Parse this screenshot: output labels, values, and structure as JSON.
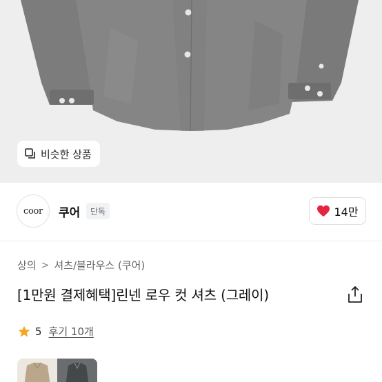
{
  "similar_button": {
    "label": "비슷한 상품",
    "icon": "copy-squares-icon"
  },
  "seller": {
    "avatar_text": "coor",
    "name": "쿠어",
    "badge": "단독",
    "likes": "14만",
    "heart_color": "#e5243f"
  },
  "breadcrumb": {
    "items": [
      "상의",
      "셔츠/블라우스 (쿠어)"
    ],
    "separator": ">"
  },
  "product": {
    "title": "[1만원 결제혜택]린넨 로우 컷 셔츠 (그레이)"
  },
  "rating": {
    "score": "5",
    "reviews": "후기 10개",
    "star_color": "#f5a623"
  }
}
